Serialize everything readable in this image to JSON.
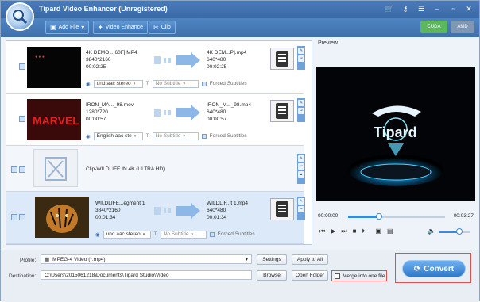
{
  "window": {
    "title": "Tipard Video Enhancer (Unregistered)"
  },
  "titlebar_icons": [
    "cart-icon",
    "key-icon",
    "feedback-icon",
    "minimize-icon",
    "restore-icon",
    "close-icon"
  ],
  "toolbar": {
    "add_file": "Add File",
    "video_enhance": "Video Enhance",
    "clip": "Clip",
    "cuda": "CUDA",
    "amd": "AMD"
  },
  "files": [
    {
      "name": "4K DEMO ...60F].MP4",
      "resolution": "3840*2160",
      "duration": "00:02:25",
      "out_name": "4K DEM...P].mp4",
      "out_resolution": "640*480",
      "out_duration": "00:02:25",
      "audio": "und aac stereo",
      "subtitle": "No Subtitle",
      "forced": "Forced Subtitles"
    },
    {
      "name": "IRON_MA..._98.mov",
      "resolution": "1280*720",
      "duration": "00:00:57",
      "out_name": "IRON_M..._98.mp4",
      "out_resolution": "640*480",
      "out_duration": "00:00:57",
      "audio": "English aac ste",
      "subtitle": "No Subtitle",
      "forced": "Forced Subtitles"
    },
    {
      "name": "Clip-WILDLIFE IN 4K (ULTRA HD)"
    },
    {
      "name": "WILDLIFE...egment 1",
      "resolution": "3840*2160",
      "duration": "00:01:34",
      "out_name": "WILDLIF...t 1.mp4",
      "out_resolution": "640*480",
      "out_duration": "00:01:34",
      "audio": "und aac stereo",
      "subtitle": "No Subtitle",
      "forced": "Forced Subtitles"
    }
  ],
  "preview": {
    "label": "Preview",
    "brand": "Tipard",
    "time_start": "00:00:00",
    "time_end": "00:03:27",
    "progress": 0.32,
    "volume": 0.65
  },
  "bottom": {
    "profile_label": "Profile:",
    "profile_value": "MPEG-4 Video (*.mp4)",
    "settings": "Settings",
    "apply_all": "Apply to All",
    "destination_label": "Destination:",
    "destination_value": "C:\\Users\\2015061218\\Documents\\Tipard Studio\\Video",
    "browse": "Browse",
    "open_folder": "Open Folder",
    "merge": "Merge into one file",
    "convert": "Convert"
  },
  "colors": {
    "accent": "#3a72b3",
    "convert": "#2f79c9",
    "highlight": "#e05050"
  }
}
